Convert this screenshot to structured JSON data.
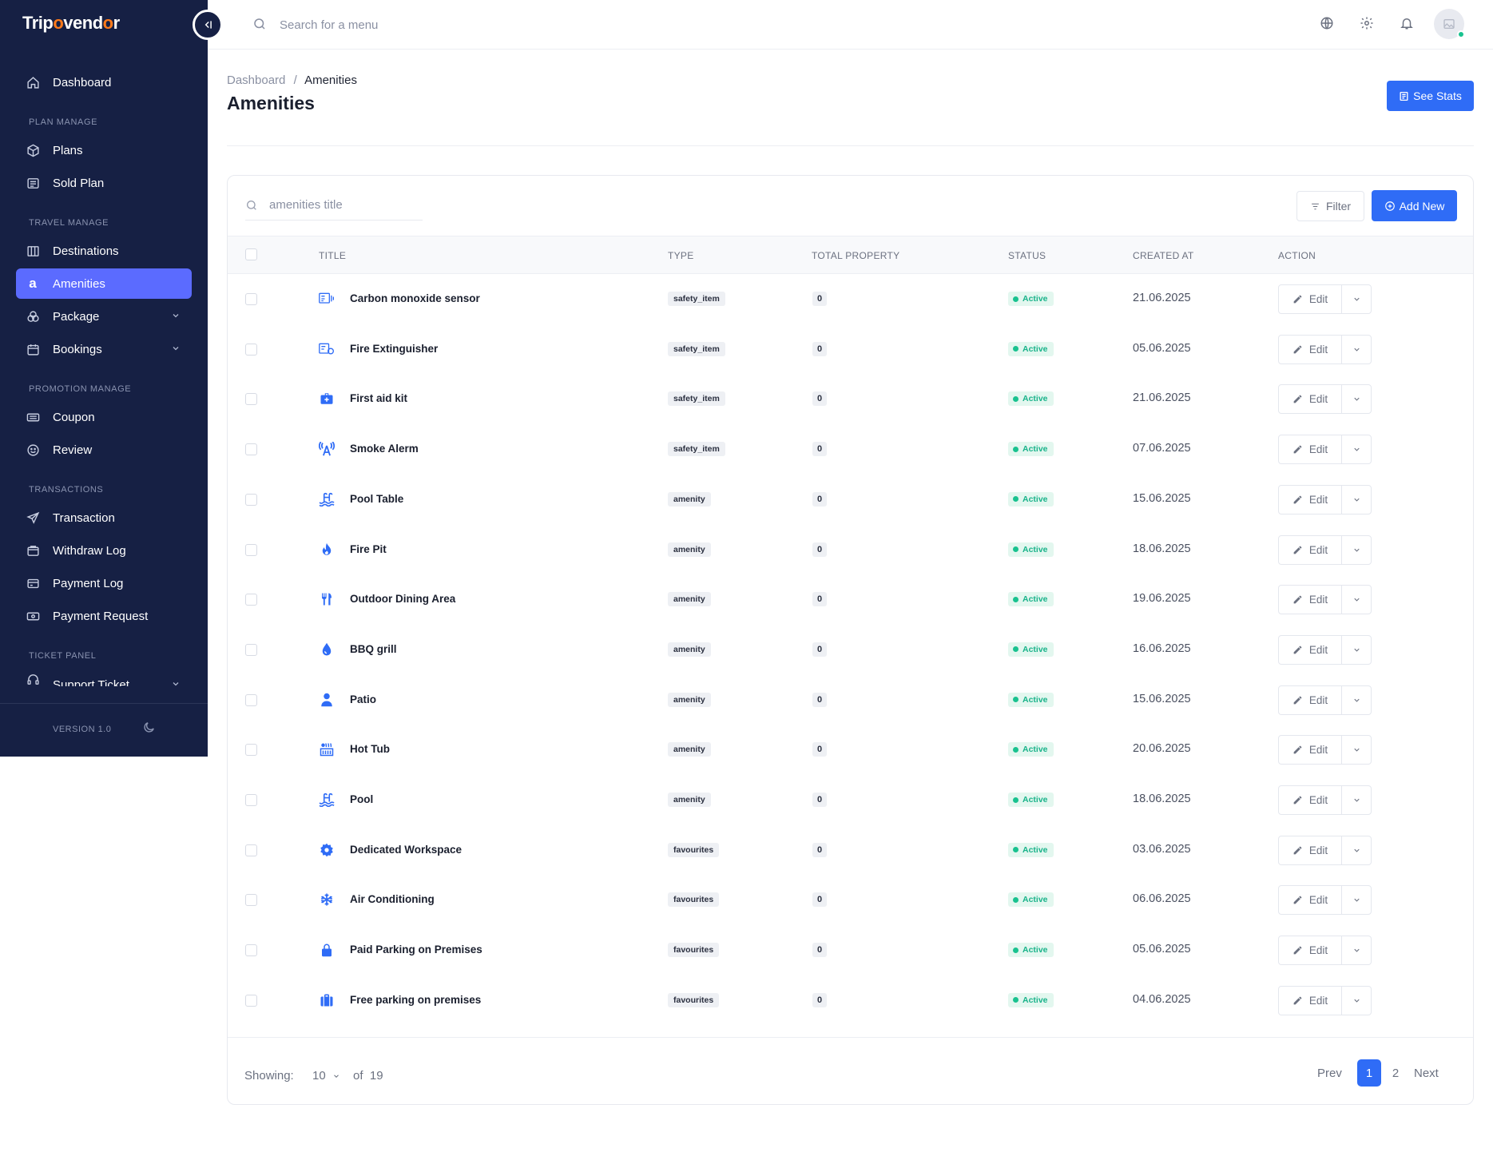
{
  "app": {
    "logo_prefix": "Trip",
    "logo_o": "o",
    "logo_middle": "vend",
    "logo_o2": "o",
    "logo_suffix": "r",
    "version": "VERSION 1.0"
  },
  "search": {
    "placeholder": "Search for a menu"
  },
  "sidebar": {
    "dashboard": "Dashboard",
    "sections": {
      "plan": "PLAN MANAGE",
      "travel": "TRAVEL MANAGE",
      "promotion": "PROMOTION MANAGE",
      "transactions": "TRANSACTIONS",
      "ticket": "TICKET PANEL"
    },
    "items": {
      "plans": "Plans",
      "sold_plan": "Sold Plan",
      "destinations": "Destinations",
      "amenities": "Amenities",
      "package": "Package",
      "bookings": "Bookings",
      "coupon": "Coupon",
      "review": "Review",
      "transaction": "Transaction",
      "withdraw_log": "Withdraw Log",
      "payment_log": "Payment Log",
      "payment_request": "Payment Request",
      "support_ticket": "Support Ticket"
    }
  },
  "breadcrumb": {
    "root": "Dashboard",
    "sep": "/",
    "current": "Amenities"
  },
  "page": {
    "title": "Amenities",
    "see_stats": "See Stats"
  },
  "table": {
    "search_placeholder": "amenities title",
    "filter_label": "Filter",
    "add_new_label": "Add New",
    "columns": {
      "title": "TITLE",
      "type": "TYPE",
      "total_property": "TOTAL PROPERTY",
      "status": "STATUS",
      "created_at": "CREATED AT",
      "action": "ACTION"
    },
    "edit_label": "Edit",
    "rows": [
      {
        "icon": "sensor-icon",
        "title": "Carbon monoxide sensor",
        "type": "safety_item",
        "total": "0",
        "status": "Active",
        "created": "21.06.2025"
      },
      {
        "icon": "extinguisher-icon",
        "title": "Fire Extinguisher",
        "type": "safety_item",
        "total": "0",
        "status": "Active",
        "created": "05.06.2025"
      },
      {
        "icon": "first-aid-icon",
        "title": "First aid kit",
        "type": "safety_item",
        "total": "0",
        "status": "Active",
        "created": "21.06.2025"
      },
      {
        "icon": "alarm-icon",
        "title": "Smoke Alerm",
        "type": "safety_item",
        "total": "0",
        "status": "Active",
        "created": "07.06.2025"
      },
      {
        "icon": "pool-icon",
        "title": "Pool Table",
        "type": "amenity",
        "total": "0",
        "status": "Active",
        "created": "15.06.2025"
      },
      {
        "icon": "flame-icon",
        "title": "Fire Pit",
        "type": "amenity",
        "total": "0",
        "status": "Active",
        "created": "18.06.2025"
      },
      {
        "icon": "utensils-icon",
        "title": "Outdoor Dining Area",
        "type": "amenity",
        "total": "0",
        "status": "Active",
        "created": "19.06.2025"
      },
      {
        "icon": "drop-icon",
        "title": "BBQ grill",
        "type": "amenity",
        "total": "0",
        "status": "Active",
        "created": "16.06.2025"
      },
      {
        "icon": "person-icon",
        "title": "Patio",
        "type": "amenity",
        "total": "0",
        "status": "Active",
        "created": "15.06.2025"
      },
      {
        "icon": "hot-tub-icon",
        "title": "Hot Tub",
        "type": "amenity",
        "total": "0",
        "status": "Active",
        "created": "20.06.2025"
      },
      {
        "icon": "pool-icon",
        "title": "Pool",
        "type": "amenity",
        "total": "0",
        "status": "Active",
        "created": "18.06.2025"
      },
      {
        "icon": "gear-icon",
        "title": "Dedicated Workspace",
        "type": "favourites",
        "total": "0",
        "status": "Active",
        "created": "03.06.2025"
      },
      {
        "icon": "snowflake-icon",
        "title": "Air Conditioning",
        "type": "favourites",
        "total": "0",
        "status": "Active",
        "created": "06.06.2025"
      },
      {
        "icon": "lock-icon",
        "title": "Paid Parking on Premises",
        "type": "favourites",
        "total": "0",
        "status": "Active",
        "created": "05.06.2025"
      },
      {
        "icon": "suitcase-icon",
        "title": "Free parking on premises",
        "type": "favourites",
        "total": "0",
        "status": "Active",
        "created": "04.06.2025"
      }
    ]
  },
  "pagination": {
    "showing_label": "Showing:",
    "per_page": "10",
    "of_label": "of",
    "total": "19",
    "prev": "Prev",
    "pages": [
      "1",
      "2"
    ],
    "current": "1",
    "next": "Next"
  },
  "colors": {
    "sidebar_bg": "#162044",
    "active_item": "#5b6bff",
    "primary": "#2f6cf6",
    "status_active": "#19b38a",
    "logo_accent": "#ff7a1a"
  }
}
